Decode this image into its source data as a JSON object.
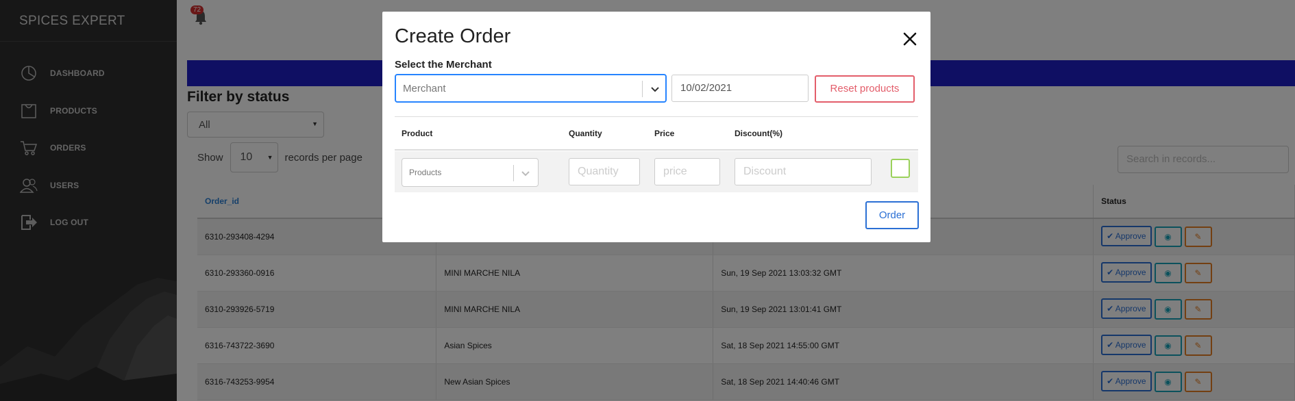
{
  "app": {
    "brand": "SPICES EXPERT"
  },
  "sidebar": {
    "items": [
      {
        "label": "DASHBOARD",
        "icon": "dashboard-icon"
      },
      {
        "label": "PRODUCTS",
        "icon": "products-icon"
      },
      {
        "label": "ORDERS",
        "icon": "cart-icon"
      },
      {
        "label": "USERS",
        "icon": "users-icon"
      },
      {
        "label": "LOG OUT",
        "icon": "logout-icon"
      }
    ]
  },
  "header": {
    "notification_count": "72"
  },
  "filter": {
    "title": "Filter by status",
    "status_value": "All",
    "show_label": "Show",
    "per_page_value": "10",
    "per_page_suffix": "records per page",
    "search_placeholder": "Search in records..."
  },
  "table": {
    "columns": {
      "order_id": "Order_id",
      "status": "Status"
    },
    "approve_label": "Approve",
    "rows": [
      {
        "order_id": "6310-293408-4294",
        "merchant": "",
        "date": ""
      },
      {
        "order_id": "6310-293360-0916",
        "merchant": "MINI MARCHE NILA",
        "date": "Sun, 19 Sep 2021 13:03:32 GMT"
      },
      {
        "order_id": "6310-293926-5719",
        "merchant": "MINI MARCHE NILA",
        "date": "Sun, 19 Sep 2021 13:01:41 GMT"
      },
      {
        "order_id": "6316-743722-3690",
        "merchant": "Asian Spices",
        "date": "Sat, 18 Sep 2021 14:55:00 GMT"
      },
      {
        "order_id": "6316-743253-9954",
        "merchant": "New Asian Spices",
        "date": "Sat, 18 Sep 2021 14:40:46 GMT"
      }
    ]
  },
  "modal": {
    "title": "Create Order",
    "merchant_label": "Select the Merchant",
    "merchant_placeholder": "Merchant",
    "date_value": "10/02/2021",
    "reset_label": "Reset products",
    "columns": {
      "product": "Product",
      "quantity": "Quantity",
      "price": "Price",
      "discount": "Discount(%)"
    },
    "products_placeholder": "Products",
    "quantity_placeholder": "Quantity",
    "price_placeholder": "price",
    "discount_placeholder": "Discount",
    "order_label": "Order"
  },
  "colors": {
    "sidebar_bg": "#2f2f2f",
    "banner": "#1f1fc7",
    "primary": "#2a6fd4",
    "danger": "#e35d6a",
    "info": "#17a2b8",
    "warning": "#e67e22",
    "badge": "#d32f2f",
    "check": "#9ad15a"
  }
}
